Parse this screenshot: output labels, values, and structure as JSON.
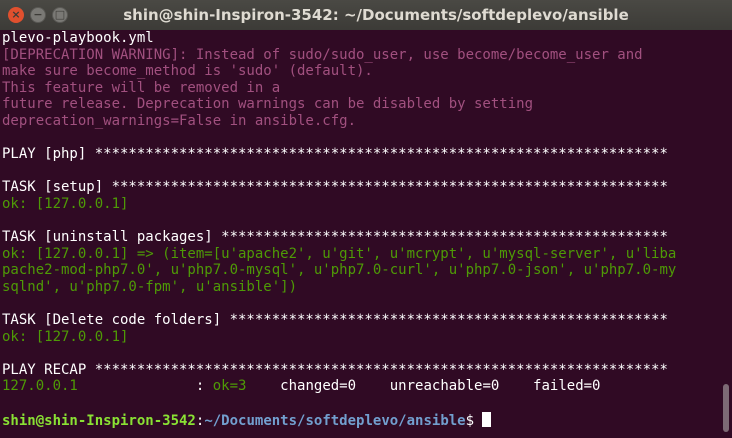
{
  "window": {
    "title": "shin@shin-Inspiron-3542: ~/Documents/softdeplevo/ansible",
    "close_glyph": "×",
    "minimize_glyph": "−",
    "maximize_glyph": "□"
  },
  "colors": {
    "background": "#300a24",
    "warning": "#a1507f",
    "ok": "#4e9a06",
    "prompt_user": "#8ae234",
    "prompt_path": "#729fcf"
  },
  "lines": [
    {
      "text": "plevo-playbook.yml",
      "style": "normal"
    },
    {
      "text": "[DEPRECATION WARNING]: Instead of sudo/sudo_user, use become/become_user and",
      "style": "warn"
    },
    {
      "text": "make sure become_method is 'sudo' (default).",
      "style": "warn"
    },
    {
      "text": "This feature will be removed in a",
      "style": "warn"
    },
    {
      "text": "future release. Deprecation warnings can be disabled by setting",
      "style": "warn"
    },
    {
      "text": "deprecation_warnings=False in ansible.cfg.",
      "style": "warn"
    },
    {
      "text": "",
      "style": "normal"
    },
    {
      "text": "PLAY [php] ********************************************************************",
      "style": "normal"
    },
    {
      "text": "",
      "style": "normal"
    },
    {
      "text": "TASK [setup] ******************************************************************",
      "style": "normal"
    },
    {
      "text": "ok: [127.0.0.1]",
      "style": "ok"
    },
    {
      "text": "",
      "style": "normal"
    },
    {
      "text": "TASK [uninstall packages] *****************************************************",
      "style": "normal"
    },
    {
      "text": "ok: [127.0.0.1] => (item=[u'apache2', u'git', u'mcrypt', u'mysql-server', u'liba",
      "style": "ok"
    },
    {
      "text": "pache2-mod-php7.0', u'php7.0-mysql', u'php7.0-curl', u'php7.0-json', u'php7.0-my",
      "style": "ok"
    },
    {
      "text": "sqlnd', u'php7.0-fpm', u'ansible'])",
      "style": "ok"
    },
    {
      "text": "",
      "style": "normal"
    },
    {
      "text": "TASK [Delete code folders] ****************************************************",
      "style": "normal"
    },
    {
      "text": "ok: [127.0.0.1]",
      "style": "ok"
    },
    {
      "text": "",
      "style": "normal"
    },
    {
      "text": "PLAY RECAP ********************************************************************",
      "style": "normal"
    }
  ],
  "recap": {
    "host": "127.0.0.1",
    "separator": ": ",
    "ok": "ok=3",
    "changed": "changed=0",
    "unreachable": "unreachable=0",
    "failed": "failed=0"
  },
  "prompt": {
    "user_host": "shin@shin-Inspiron-3542",
    "colon": ":",
    "path": "~/Documents/softdeplevo/ansible",
    "symbol": "$ "
  }
}
